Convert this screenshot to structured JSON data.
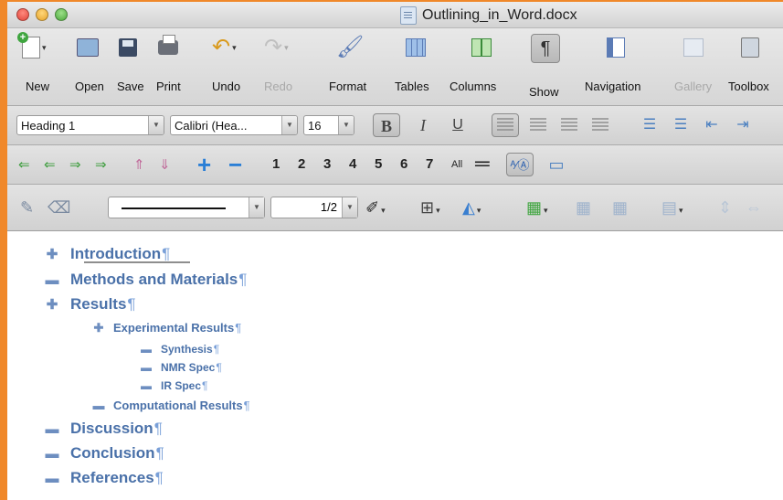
{
  "window": {
    "title": "Outlining_in_Word.docx"
  },
  "toolbar": {
    "items": [
      {
        "label": "New",
        "icon": "new-document-icon",
        "disabled": false
      },
      {
        "label": "Open",
        "icon": "open-icon",
        "disabled": false
      },
      {
        "label": "Save",
        "icon": "save-icon",
        "disabled": false
      },
      {
        "label": "Print",
        "icon": "print-icon",
        "disabled": false
      },
      {
        "label": "Undo",
        "icon": "undo-icon",
        "disabled": false
      },
      {
        "label": "Redo",
        "icon": "redo-icon",
        "disabled": true
      },
      {
        "label": "Format",
        "icon": "format-brush-icon",
        "disabled": false
      },
      {
        "label": "Tables",
        "icon": "table-icon",
        "disabled": false
      },
      {
        "label": "Columns",
        "icon": "columns-icon",
        "disabled": false
      },
      {
        "label": "Show",
        "icon": "pilcrow-icon",
        "disabled": false,
        "active": true
      },
      {
        "label": "Navigation",
        "icon": "navigation-pane-icon",
        "disabled": false
      },
      {
        "label": "Gallery",
        "icon": "gallery-icon",
        "disabled": true
      },
      {
        "label": "Toolbox",
        "icon": "toolbox-icon",
        "disabled": false
      }
    ]
  },
  "formatting": {
    "style": "Heading 1",
    "font": "Calibri (Hea...",
    "size": "16",
    "bold": "B",
    "italic": "I",
    "underline": "U"
  },
  "outlining": {
    "levels": [
      "1",
      "2",
      "3",
      "4",
      "5",
      "6",
      "7"
    ],
    "all_label": "All"
  },
  "drawing": {
    "line_weight": "1/2"
  },
  "outline": [
    {
      "text": "Introduction",
      "level": 1,
      "expandable": true
    },
    {
      "text": "Methods and Materials",
      "level": 1,
      "expandable": false
    },
    {
      "text": "Results",
      "level": 1,
      "expandable": true
    },
    {
      "text": "Experimental Results",
      "level": 2,
      "expandable": true
    },
    {
      "text": "Synthesis ",
      "level": 3,
      "expandable": false
    },
    {
      "text": "NMR Spec",
      "level": 3,
      "expandable": false
    },
    {
      "text": "IR Spec",
      "level": 3,
      "expandable": false
    },
    {
      "text": "Computational Results",
      "level": 2,
      "expandable": false
    },
    {
      "text": "Discussion",
      "level": 1,
      "expandable": false
    },
    {
      "text": "Conclusion ",
      "level": 1,
      "expandable": false
    },
    {
      "text": "References",
      "level": 1,
      "expandable": false
    }
  ],
  "colors": {
    "window_border": "#f0882a",
    "heading_text": "#4a71a9",
    "outline_symbol": "#6d8ec0"
  }
}
